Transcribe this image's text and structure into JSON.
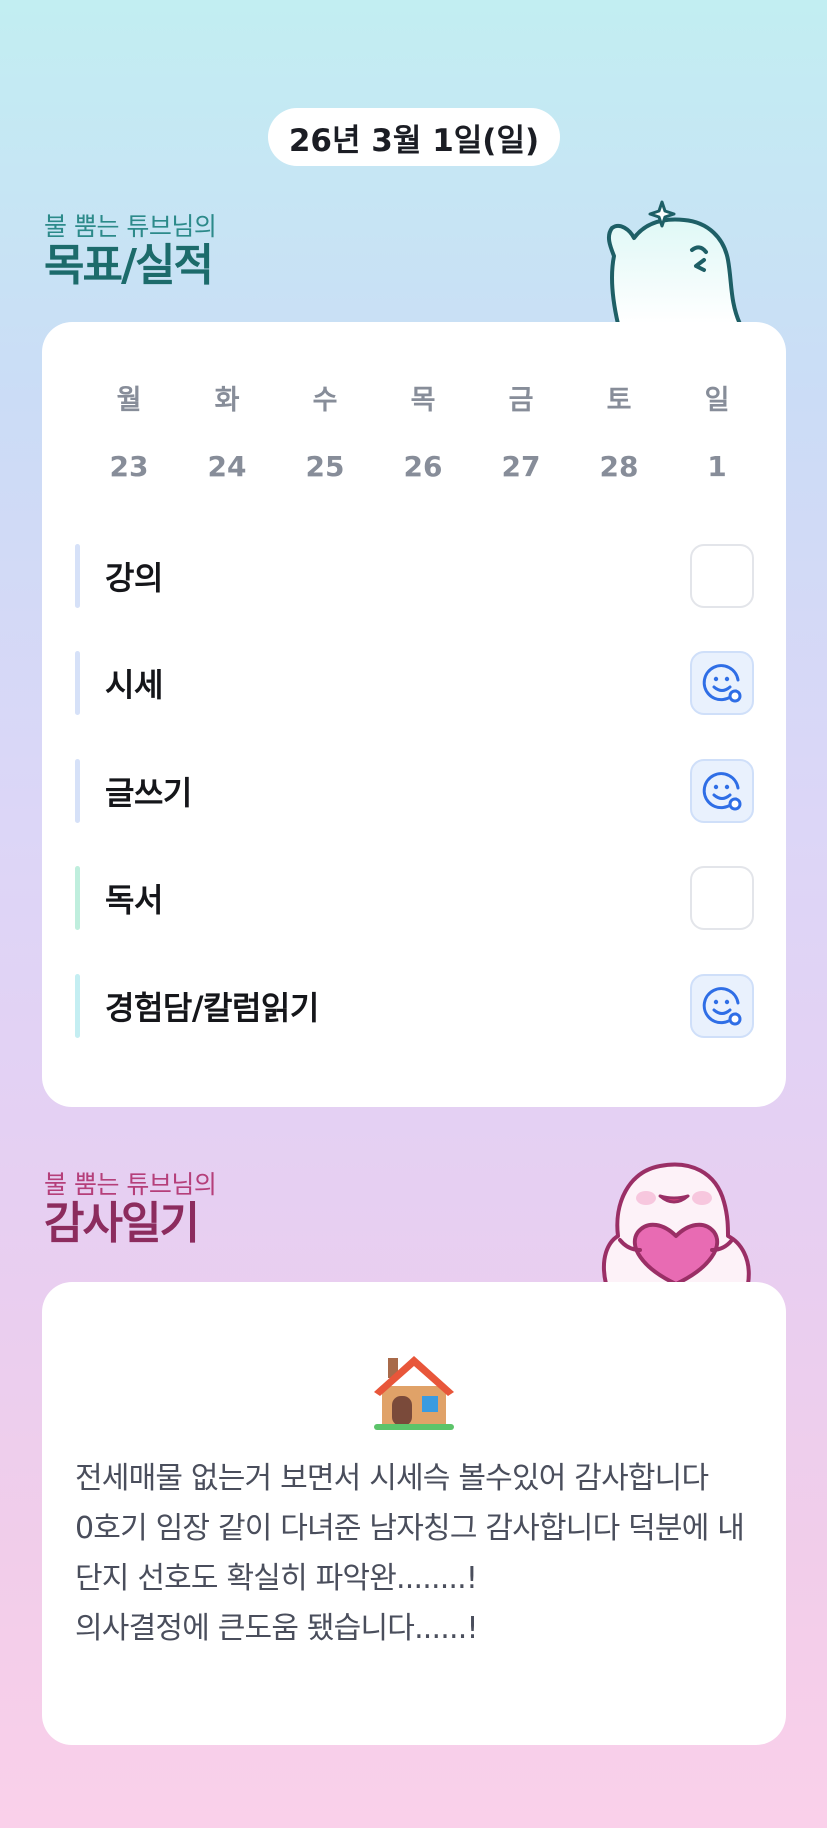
{
  "header": {
    "date": "26년 3월 1일(일)"
  },
  "goals_section": {
    "subtitle": "불 뿜는 튜브님의",
    "title": "목표/실적",
    "weekdays": [
      "월",
      "화",
      "수",
      "목",
      "금",
      "토",
      "일"
    ],
    "dates": [
      "23",
      "24",
      "25",
      "26",
      "27",
      "28",
      "1"
    ],
    "items": [
      {
        "label": "강의",
        "done": false,
        "bar_color": "#d6e1f8"
      },
      {
        "label": "시세",
        "done": true,
        "bar_color": "#d6e1f8"
      },
      {
        "label": "글쓰기",
        "done": true,
        "bar_color": "#d6e1f8"
      },
      {
        "label": "독서",
        "done": false,
        "bar_color": "#bfeedd"
      },
      {
        "label": "경험담/칼럼읽기",
        "done": true,
        "bar_color": "#c4eef2"
      }
    ],
    "done_icon": "smile-icon",
    "accent": "#2f6ee6"
  },
  "gratitude_section": {
    "subtitle": "불 뿜는 튜브님의",
    "title": "감사일기",
    "icon": "house-icon",
    "text": "전세매물 없는거 보면서 시세슥 볼수있어 감사합니다\n0호기 임장 같이 다녀준 남자칭그 감사합니다 덕분에 내 단지 선호도 확실히 파악완........!\n의사결정에 큰도움 됐습니다......!"
  }
}
